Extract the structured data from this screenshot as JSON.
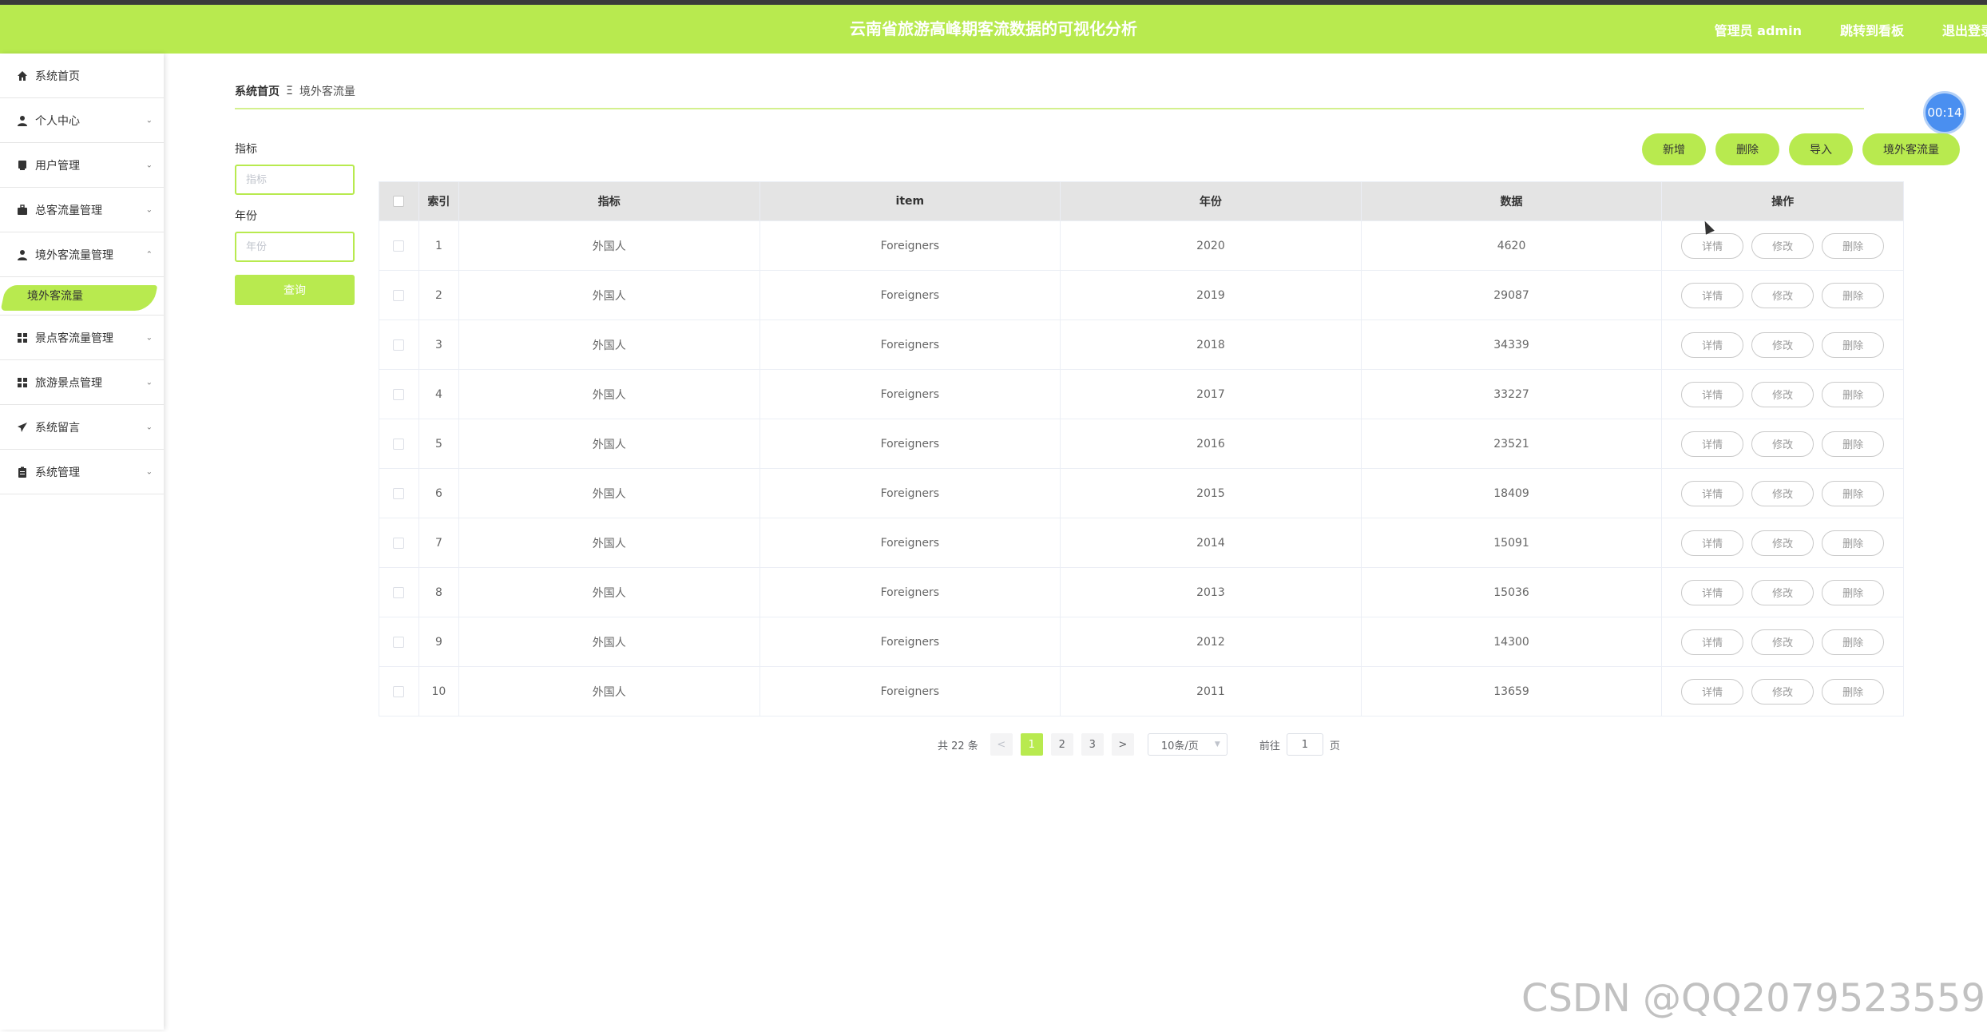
{
  "header": {
    "title": "云南省旅游高峰期客流数据的可视化分析",
    "admin": "管理员 admin",
    "dashboard": "跳转到看板",
    "logout": "退出登录"
  },
  "sidebar": {
    "items": [
      {
        "label": "系统首页",
        "icon": "home-icon",
        "chevron": ""
      },
      {
        "label": "个人中心",
        "icon": "user-icon",
        "chevron": "⌄"
      },
      {
        "label": "用户管理",
        "icon": "user-management-icon",
        "chevron": "⌄"
      },
      {
        "label": "总客流量管理",
        "icon": "briefcase-icon",
        "chevron": "⌄"
      },
      {
        "label": "境外客流量管理",
        "icon": "user-icon",
        "chevron": "⌃"
      },
      {
        "label": "景点客流量管理",
        "icon": "grid-icon",
        "chevron": "⌄"
      },
      {
        "label": "旅游景点管理",
        "icon": "grid-icon",
        "chevron": "⌄"
      },
      {
        "label": "系统留言",
        "icon": "paper-plane-icon",
        "chevron": "⌄"
      },
      {
        "label": "系统管理",
        "icon": "clipboard-icon",
        "chevron": "⌄"
      }
    ],
    "active_sub": "境外客流量"
  },
  "breadcrumb": {
    "home": "系统首页",
    "sep": "Ξ",
    "current": "境外客流量"
  },
  "timer": "00:14",
  "search": {
    "field1_label": "指标",
    "field1_placeholder": "指标",
    "field2_label": "年份",
    "field2_placeholder": "年份",
    "query_label": "查询"
  },
  "actions": {
    "add": "新增",
    "delete": "删除",
    "import": "导入",
    "chart": "境外客流量"
  },
  "table": {
    "headers": {
      "index": "索引",
      "indicator": "指标",
      "item": "item",
      "year": "年份",
      "data": "数据",
      "ops": "操作"
    },
    "rows": [
      {
        "index": "1",
        "indicator": "外国人",
        "item": "Foreigners",
        "year": "2020",
        "data": "4620"
      },
      {
        "index": "2",
        "indicator": "外国人",
        "item": "Foreigners",
        "year": "2019",
        "data": "29087"
      },
      {
        "index": "3",
        "indicator": "外国人",
        "item": "Foreigners",
        "year": "2018",
        "data": "34339"
      },
      {
        "index": "4",
        "indicator": "外国人",
        "item": "Foreigners",
        "year": "2017",
        "data": "33227"
      },
      {
        "index": "5",
        "indicator": "外国人",
        "item": "Foreigners",
        "year": "2016",
        "data": "23521"
      },
      {
        "index": "6",
        "indicator": "外国人",
        "item": "Foreigners",
        "year": "2015",
        "data": "18409"
      },
      {
        "index": "7",
        "indicator": "外国人",
        "item": "Foreigners",
        "year": "2014",
        "data": "15091"
      },
      {
        "index": "8",
        "indicator": "外国人",
        "item": "Foreigners",
        "year": "2013",
        "data": "15036"
      },
      {
        "index": "9",
        "indicator": "外国人",
        "item": "Foreigners",
        "year": "2012",
        "data": "14300"
      },
      {
        "index": "10",
        "indicator": "外国人",
        "item": "Foreigners",
        "year": "2011",
        "data": "13659"
      }
    ],
    "op_labels": {
      "detail": "详情",
      "edit": "修改",
      "delete": "删除"
    }
  },
  "pager": {
    "total": "共 22 条",
    "prev": "<",
    "pages": [
      "1",
      "2",
      "3"
    ],
    "next": ">",
    "page_size": "10条/页",
    "goto_label": "前往",
    "goto_value": "1",
    "goto_suffix": "页"
  },
  "watermark": "CSDN @QQ2079523559",
  "colors": {
    "accent": "#b8ea4f",
    "timer": "#4a8ff0"
  }
}
